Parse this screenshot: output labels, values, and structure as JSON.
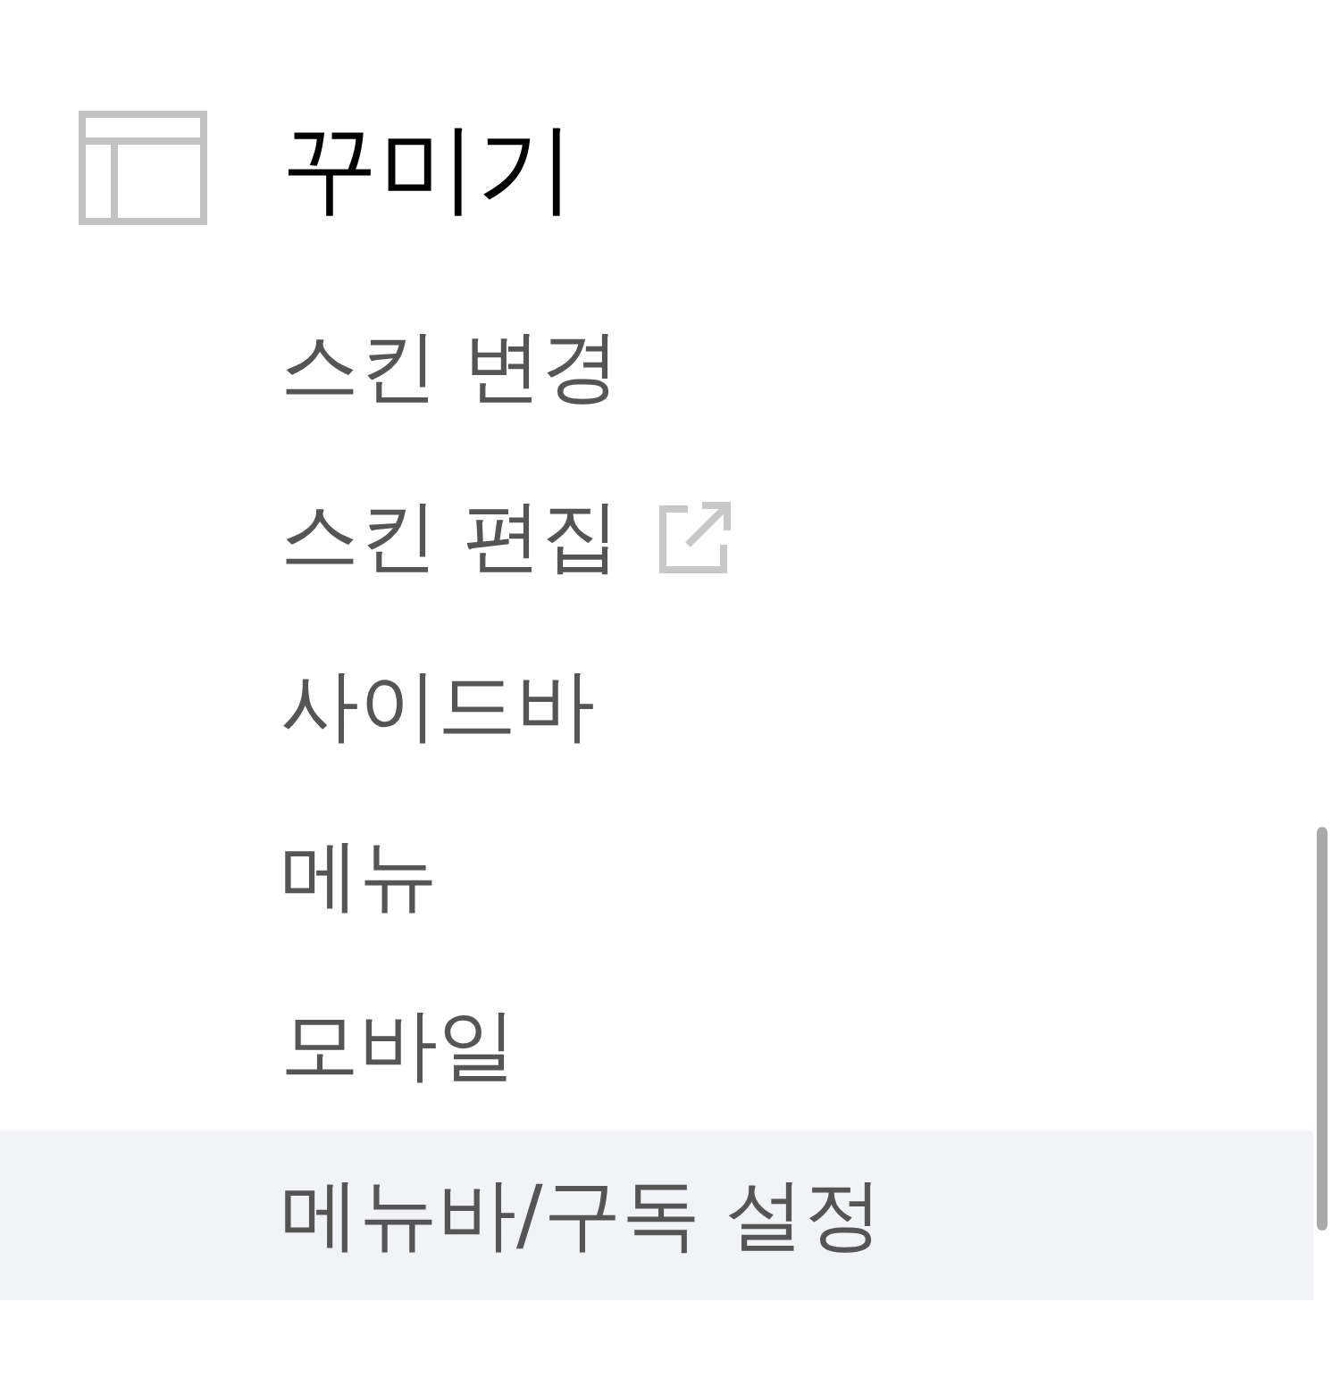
{
  "section": {
    "title": "꾸미기"
  },
  "items": [
    {
      "label": "스킨 변경",
      "external": false,
      "selected": false
    },
    {
      "label": "스킨 편집",
      "external": true,
      "selected": false
    },
    {
      "label": "사이드바",
      "external": false,
      "selected": false
    },
    {
      "label": "메뉴",
      "external": false,
      "selected": false
    },
    {
      "label": "모바일",
      "external": false,
      "selected": false
    },
    {
      "label": "메뉴바/구독 설정",
      "external": false,
      "selected": true
    }
  ]
}
